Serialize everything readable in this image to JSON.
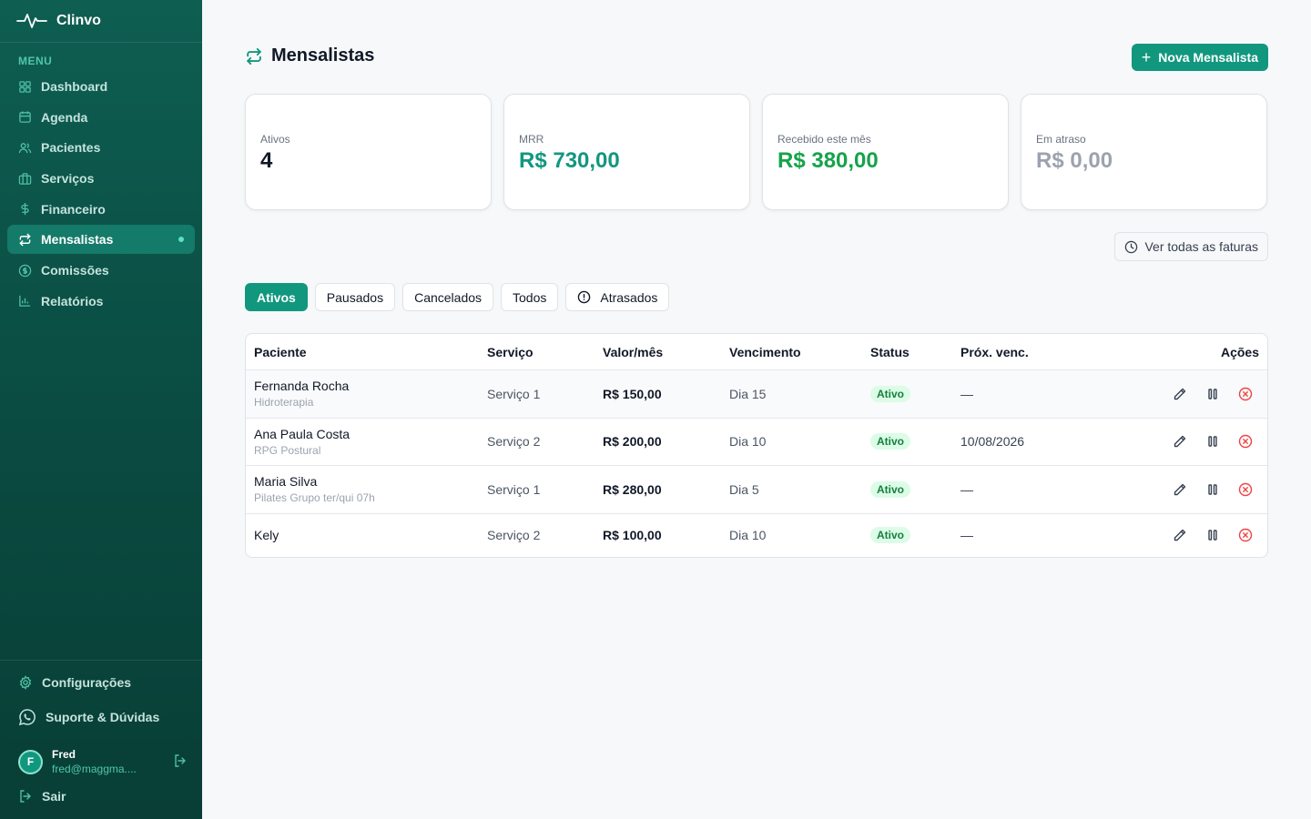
{
  "app": {
    "name": "Clinvo"
  },
  "sidebar": {
    "menu_label": "MENU",
    "items": [
      {
        "label": "Dashboard",
        "icon": "grid-icon"
      },
      {
        "label": "Agenda",
        "icon": "calendar-icon"
      },
      {
        "label": "Pacientes",
        "icon": "users-icon"
      },
      {
        "label": "Serviços",
        "icon": "briefcase-icon"
      },
      {
        "label": "Financeiro",
        "icon": "dollar-icon"
      },
      {
        "label": "Mensalistas",
        "icon": "repeat-icon",
        "active": true
      },
      {
        "label": "Comissões",
        "icon": "coin-icon"
      },
      {
        "label": "Relatórios",
        "icon": "bar-chart-icon"
      }
    ],
    "settings_label": "Configurações",
    "support_label": "Suporte & Dúvidas",
    "user": {
      "initial": "F",
      "name": "Fred",
      "email": "fred@maggma...."
    },
    "logout_label": "Sair"
  },
  "page": {
    "title": "Mensalistas",
    "new_button": "Nova Mensalista",
    "invoices_button": "Ver todas as faturas"
  },
  "cards": [
    {
      "label": "Ativos",
      "value": "4",
      "color": "#111827"
    },
    {
      "label": "MRR",
      "value": "R$ 730,00",
      "color": "#12977f"
    },
    {
      "label": "Recebido este mês",
      "value": "R$ 380,00",
      "color": "#16a34a"
    },
    {
      "label": "Em atraso",
      "value": "R$ 0,00",
      "color": "#9ca3af"
    }
  ],
  "tabs": [
    "Ativos",
    "Pausados",
    "Cancelados",
    "Todos",
    "Atrasados"
  ],
  "table": {
    "headers": [
      "Paciente",
      "Serviço",
      "Valor/mês",
      "Vencimento",
      "Status",
      "Próx. venc.",
      "Ações"
    ],
    "rows": [
      {
        "name": "Fernanda Rocha",
        "sub": "Hidroterapia",
        "service": "Serviço 1",
        "value": "R$ 150,00",
        "due": "Dia 15",
        "status": "Ativo",
        "next": "—"
      },
      {
        "name": "Ana Paula Costa",
        "sub": "RPG Postural",
        "service": "Serviço 2",
        "value": "R$ 200,00",
        "due": "Dia 10",
        "status": "Ativo",
        "next": "10/08/2026"
      },
      {
        "name": "Maria Silva",
        "sub": "Pilates Grupo ter/qui 07h",
        "service": "Serviço 1",
        "value": "R$ 280,00",
        "due": "Dia 5",
        "status": "Ativo",
        "next": "—"
      },
      {
        "name": "Kely",
        "sub": "",
        "service": "Serviço 2",
        "value": "R$ 100,00",
        "due": "Dia 10",
        "status": "Ativo",
        "next": "—"
      }
    ]
  },
  "colors": {
    "accent": "#12977f",
    "sidebar": "#0a4a40",
    "danger": "#ef4444"
  }
}
